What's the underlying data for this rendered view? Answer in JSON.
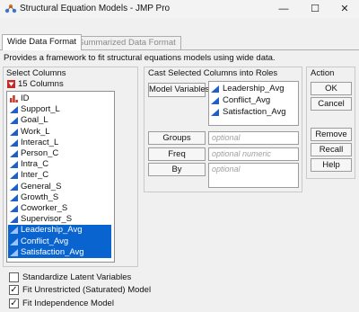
{
  "window": {
    "title": "Structural Equation Models - JMP Pro",
    "minimize_glyph": "—",
    "maximize_glyph": "☐",
    "close_glyph": "✕"
  },
  "tabs": [
    {
      "label": "Wide Data Format",
      "active": true
    },
    {
      "label": "Summarized Data Format",
      "active": false
    }
  ],
  "description": "Provides a framework to fit structural equations models using wide data.",
  "select_columns": {
    "title": "Select Columns",
    "count_label": "15 Columns",
    "columns": [
      {
        "name": "ID",
        "icon": "nominal-bar-icon",
        "selected": false
      },
      {
        "name": "Support_L",
        "icon": "continuous-triangle-icon",
        "selected": false
      },
      {
        "name": "Goal_L",
        "icon": "continuous-triangle-icon",
        "selected": false
      },
      {
        "name": "Work_L",
        "icon": "continuous-triangle-icon",
        "selected": false
      },
      {
        "name": "Interact_L",
        "icon": "continuous-triangle-icon",
        "selected": false
      },
      {
        "name": "Person_C",
        "icon": "continuous-triangle-icon",
        "selected": false
      },
      {
        "name": "Intra_C",
        "icon": "continuous-triangle-icon",
        "selected": false
      },
      {
        "name": "Inter_C",
        "icon": "continuous-triangle-icon",
        "selected": false
      },
      {
        "name": "General_S",
        "icon": "continuous-triangle-icon",
        "selected": false
      },
      {
        "name": "Growth_S",
        "icon": "continuous-triangle-icon",
        "selected": false
      },
      {
        "name": "Coworker_S",
        "icon": "continuous-triangle-icon",
        "selected": false
      },
      {
        "name": "Supervisor_S",
        "icon": "continuous-triangle-icon",
        "selected": false
      },
      {
        "name": "Leadership_Avg",
        "icon": "continuous-triangle-icon",
        "selected": true
      },
      {
        "name": "Conflict_Avg",
        "icon": "continuous-triangle-icon",
        "selected": true
      },
      {
        "name": "Satisfaction_Avg",
        "icon": "continuous-triangle-icon",
        "selected": true
      }
    ]
  },
  "cast_roles": {
    "title": "Cast Selected Columns into Roles",
    "model_variables_label": "Model Variables",
    "model_variables": [
      "Leadership_Avg",
      "Conflict_Avg",
      "Satisfaction_Avg"
    ],
    "groups_label": "Groups",
    "groups_placeholder": "optional",
    "freq_label": "Freq",
    "freq_placeholder": "optional numeric",
    "by_label": "By",
    "by_placeholder": "optional"
  },
  "action": {
    "title": "Action",
    "ok": "OK",
    "cancel": "Cancel",
    "remove": "Remove",
    "recall": "Recall",
    "help": "Help"
  },
  "options": [
    {
      "label": "Standardize Latent Variables",
      "checked": false
    },
    {
      "label": "Fit Unrestricted (Saturated) Model",
      "checked": true
    },
    {
      "label": "Fit Independence Model",
      "checked": true
    }
  ],
  "colors": {
    "selection": "#0a64d0",
    "continuous_icon": "#1f5fc8",
    "nominal_icon": "#c0392b"
  }
}
